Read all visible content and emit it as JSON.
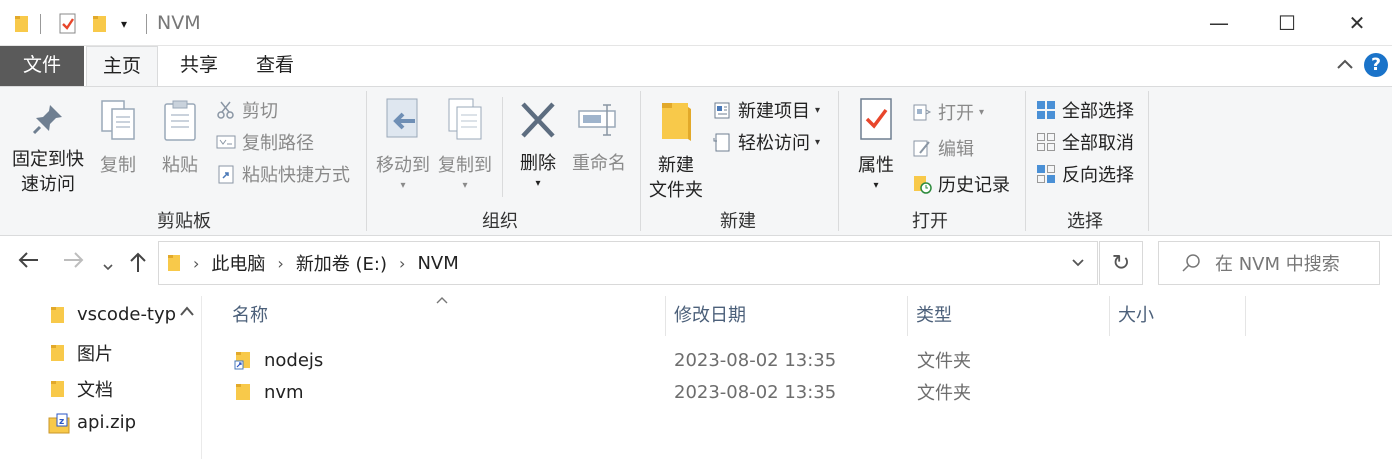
{
  "window": {
    "title": "NVM",
    "minimize_glyph": "—",
    "maximize_glyph": "☐",
    "close_glyph": "✕"
  },
  "tabs": {
    "file": "文件",
    "home": "主页",
    "share": "共享",
    "view": "查看",
    "help": "?"
  },
  "ribbon": {
    "clipboard": {
      "label": "剪贴板",
      "pin_line1": "固定到快",
      "pin_line2": "速访问",
      "copy": "复制",
      "paste": "粘贴",
      "cut": "剪切",
      "copy_path": "复制路径",
      "paste_shortcut": "粘贴快捷方式"
    },
    "organize": {
      "label": "组织",
      "move_to": "移动到",
      "copy_to": "复制到",
      "delete": "删除",
      "rename": "重命名"
    },
    "new": {
      "label": "新建",
      "new_folder_line1": "新建",
      "new_folder_line2": "文件夹",
      "new_item": "新建项目",
      "easy_access": "轻松访问"
    },
    "open": {
      "label": "打开",
      "properties": "属性",
      "open": "打开",
      "edit": "编辑",
      "history": "历史记录"
    },
    "select": {
      "label": "选择",
      "select_all": "全部选择",
      "select_none": "全部取消",
      "invert": "反向选择"
    }
  },
  "address": {
    "crumbs": [
      "此电脑",
      "新加卷 (E:)",
      "NVM"
    ],
    "search_placeholder": "在 NVM 中搜索"
  },
  "navpane": {
    "items": [
      {
        "label": "vscode-typ",
        "icon": "folder-icon"
      },
      {
        "label": "图片",
        "icon": "folder-icon"
      },
      {
        "label": "文档",
        "icon": "folder-icon"
      },
      {
        "label": "api.zip",
        "icon": "zip-icon"
      }
    ]
  },
  "filelist": {
    "columns": [
      "名称",
      "修改日期",
      "类型",
      "大小"
    ],
    "rows": [
      {
        "name": "nodejs",
        "date": "2023-08-02 13:35",
        "type": "文件夹",
        "icon": "folder-shortcut-icon"
      },
      {
        "name": "nvm",
        "date": "2023-08-02 13:35",
        "type": "文件夹",
        "icon": "folder-icon"
      }
    ]
  },
  "colors": {
    "folder": "#f8c94a",
    "accent_blue": "#1a73c9",
    "file_tab": "#5a5a5a",
    "ribbon_bg": "#f5f6f7"
  }
}
